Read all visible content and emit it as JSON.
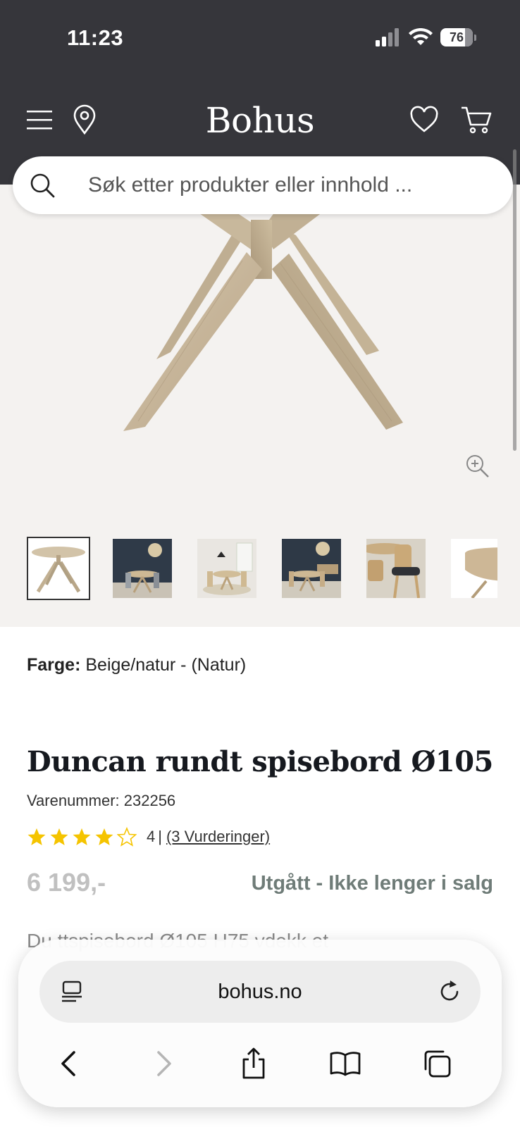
{
  "status_bar": {
    "time": "11:23",
    "battery": "76",
    "battery_level": 0.76
  },
  "header": {
    "logo": "Bohus",
    "icons": [
      "menu-icon",
      "location-pin-icon",
      "heart-icon",
      "cart-icon"
    ]
  },
  "search": {
    "placeholder": "Søk etter produkter eller innhold ..."
  },
  "gallery": {
    "thumbnail_count": 6,
    "selected_thumbnail": 1
  },
  "product": {
    "color_label": "Farge:",
    "color_value": "Beige/natur - (Natur)",
    "title": "Duncan rundt spisebord Ø105",
    "sku": "Varenummer: 232256",
    "rating_value": "4",
    "rating_stars": 4,
    "rating_separator": "|",
    "reviews_link": "(3 Vurderinger)",
    "price": "6 199,-",
    "availability": "Utgått - Ikke lenger i salg",
    "description_peek": "Du                                    ttspisebord Ø105 H75    vdekk et"
  },
  "browser": {
    "url": "bohus.no",
    "icons": [
      "reader-icon",
      "reload-icon",
      "back-icon",
      "forward-icon",
      "share-icon",
      "bookmarks-icon",
      "tabs-icon"
    ]
  },
  "colors": {
    "header_bg": "#36363b",
    "gallery_bg": "#f4f2f0",
    "wood": "#c9b89c",
    "star": "#f5c400",
    "availability": "#6f7c78"
  }
}
